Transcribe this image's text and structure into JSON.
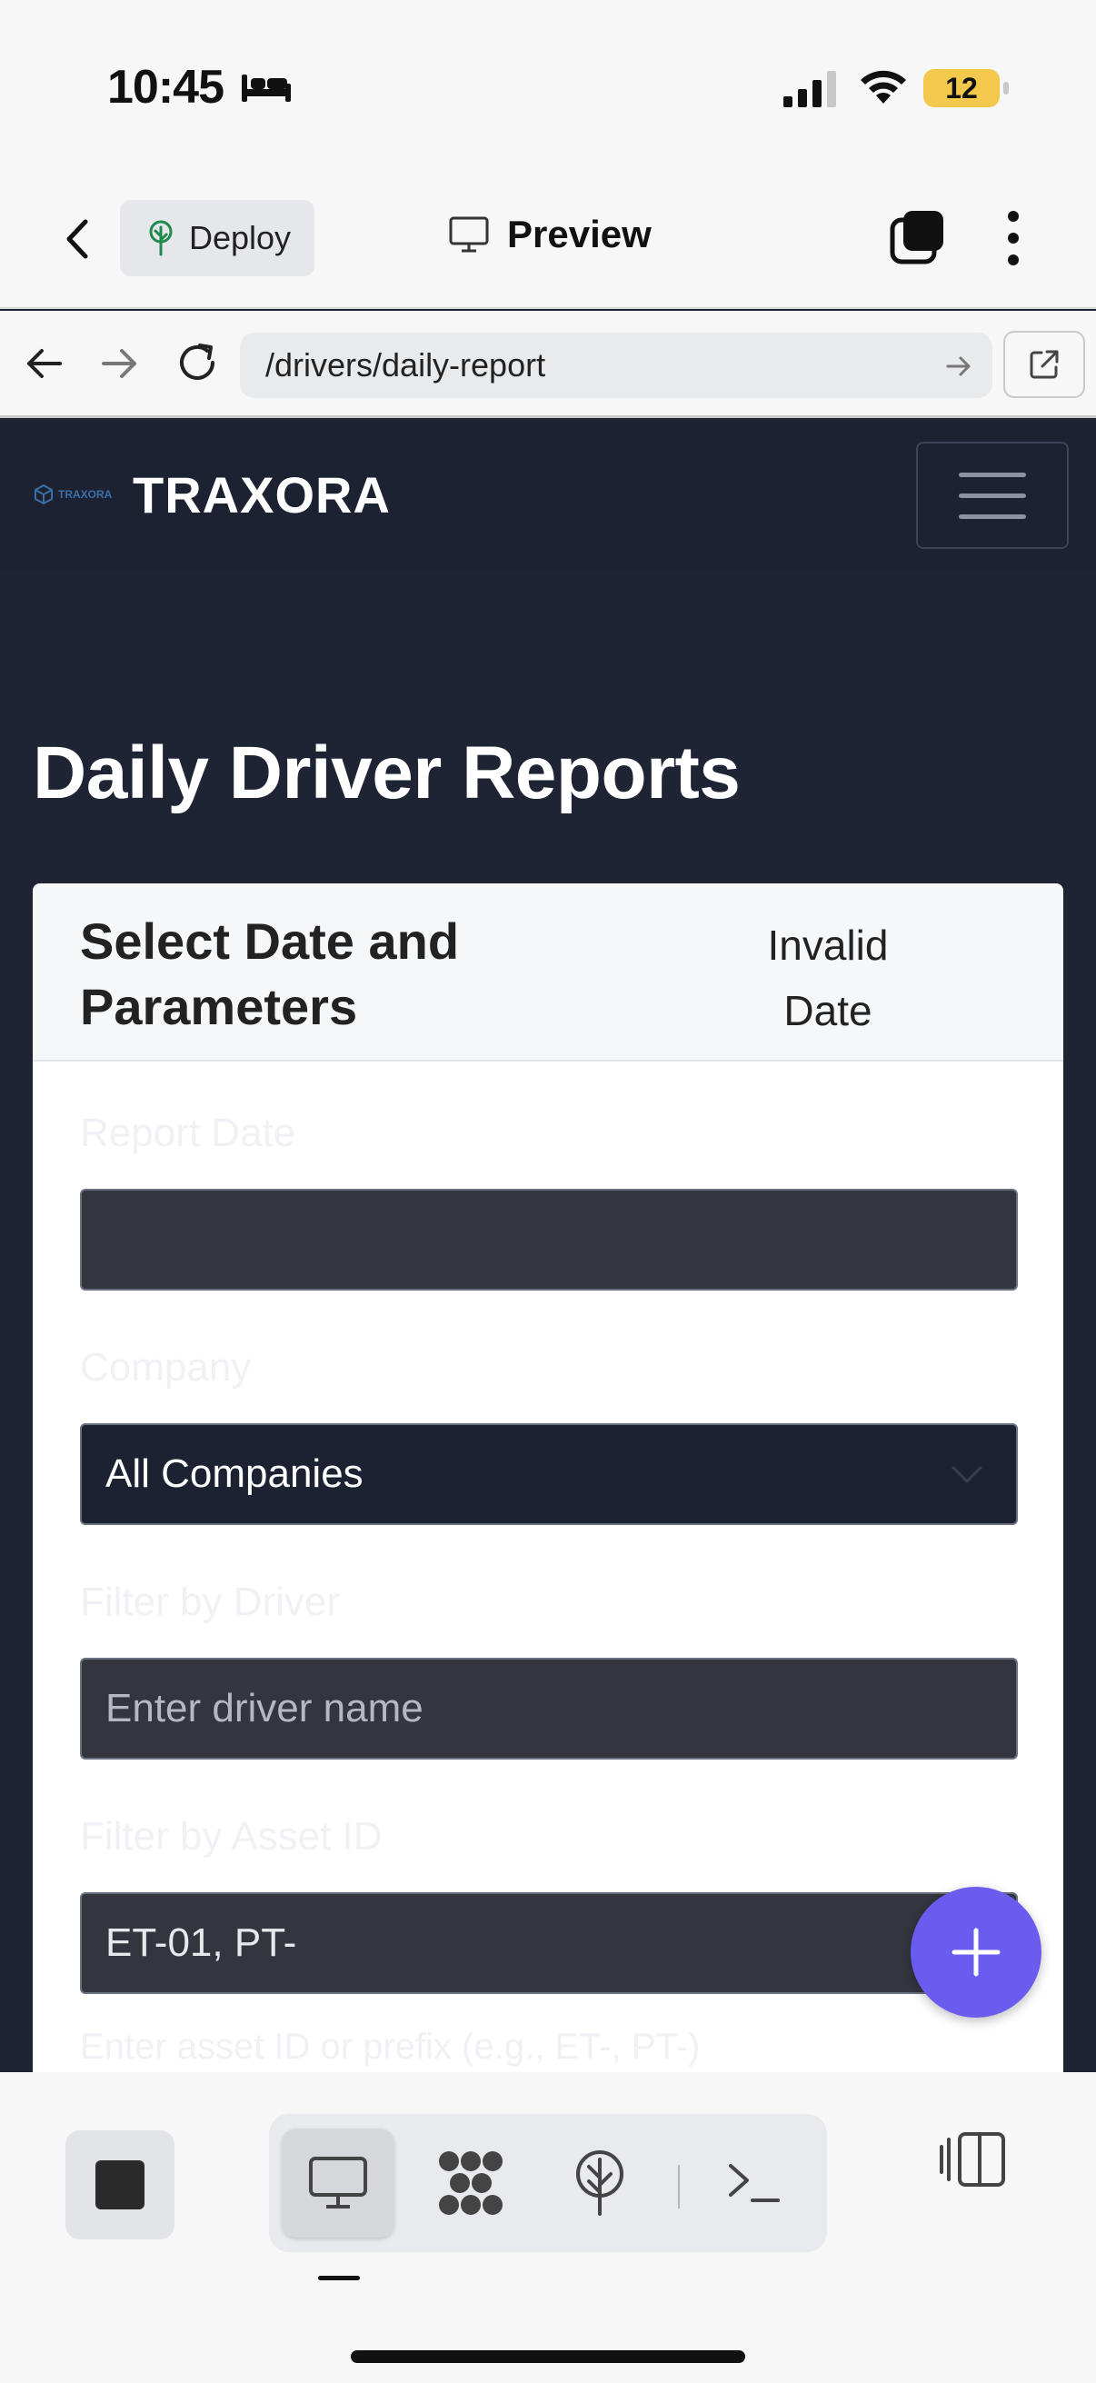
{
  "status_bar": {
    "time": "10:45",
    "battery": "12"
  },
  "toolbar": {
    "deploy_label": "Deploy",
    "preview_label": "Preview"
  },
  "browser": {
    "url": "/drivers/daily-report"
  },
  "site": {
    "logo_text": "TRAXORA",
    "brand": "TRAXORA"
  },
  "page": {
    "title": "Daily Driver Reports"
  },
  "card": {
    "title": "Select Date and Parameters",
    "status": "Invalid Date",
    "fields": {
      "report_date_label": "Report Date",
      "report_date_value": "",
      "company_label": "Company",
      "company_value": "All Companies",
      "driver_label": "Filter by Driver",
      "driver_placeholder": "Enter driver name",
      "asset_label": "Filter by Asset ID",
      "asset_value": "ET-01, PT-",
      "asset_help": "Enter asset ID or prefix (e.g., ET-, PT-)"
    }
  },
  "colors": {
    "page_bg": "#1e2433",
    "fab": "#6b5cf0",
    "battery": "#f2c94c"
  }
}
